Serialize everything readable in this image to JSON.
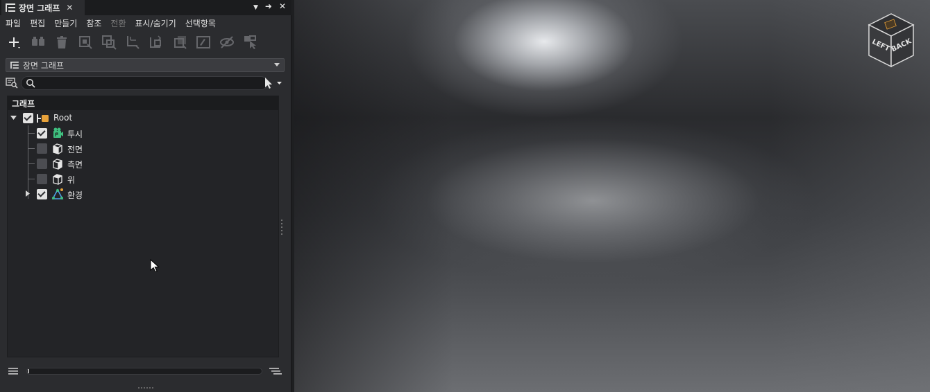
{
  "tab": {
    "title": "장면 그래프",
    "close": "✕"
  },
  "tab_controls": {
    "menu": "▼",
    "pin": "➜",
    "close": "✕"
  },
  "menu": [
    {
      "label": "파일",
      "enabled": true
    },
    {
      "label": "편집",
      "enabled": true
    },
    {
      "label": "만들기",
      "enabled": true
    },
    {
      "label": "참조",
      "enabled": true
    },
    {
      "label": "전환",
      "enabled": false
    },
    {
      "label": "표시/숨기기",
      "enabled": true
    },
    {
      "label": "선택항목",
      "enabled": true
    }
  ],
  "toolbar_icons": [
    "add-icon",
    "group-icon",
    "delete-icon",
    "frame-all-icon",
    "frame-selected-icon",
    "transform-icon",
    "pivot-icon",
    "copy-transform-icon",
    "rename-icon",
    "hide-icon",
    "select-hierarchy-icon"
  ],
  "combo": {
    "value": "장면 그래프"
  },
  "search": {
    "value": "",
    "placeholder": ""
  },
  "tree": {
    "header": "그래프",
    "root": {
      "label": "Root",
      "checked": true,
      "expanded": true
    },
    "children": [
      {
        "label": "투시",
        "checked": true,
        "icon": "perspective-camera-icon",
        "has_children": false
      },
      {
        "label": "전면",
        "checked": false,
        "icon": "front-camera-icon",
        "has_children": false
      },
      {
        "label": "측면",
        "checked": false,
        "icon": "side-camera-icon",
        "has_children": false
      },
      {
        "label": "위",
        "checked": false,
        "icon": "top-camera-icon",
        "has_children": false
      },
      {
        "label": "환경",
        "checked": true,
        "icon": "environment-icon",
        "has_children": true
      }
    ]
  },
  "viewcube": {
    "left": "LEFT",
    "back": "BACK"
  },
  "colors": {
    "accent": "#e8a23a",
    "camera_green": "#3fbf7f",
    "panel": "#2b2c2f"
  }
}
